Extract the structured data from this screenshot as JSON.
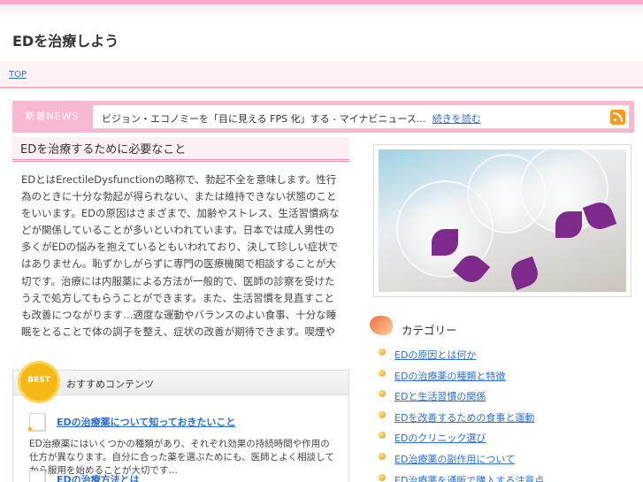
{
  "site": {
    "title": "EDを治療しよう"
  },
  "nav": {
    "top_label": "TOP"
  },
  "news": {
    "label": "新着NEWS",
    "headline": "ビジョン・エコノミーを「目に見える FPS 化」する - マイナビニュース...",
    "link_label": "続きを読む",
    "rss_icon": "rss-icon"
  },
  "main": {
    "heading": "EDを治療するために必要なこと",
    "body": "EDとはErectileDysfunctionの略称で、勃起不全を意味します。性行為のときに十分な勃起が得られない、または維持できない状態のことをいいます。EDの原因はさまざまで、加齢やストレス、生活習慣病などが関係していることが多いといわれています。日本では成人男性の多くがEDの悩みを抱えているともいわれており、決して珍しい症状ではありません。恥ずかしがらずに専門の医療機関で相談することが大切です。治療には内服薬による方法が一般的で、医師の診察を受けたうえで処方してもらうことができます。また、生活習慣を見直すことも改善につながります…適度な運動やバランスのよい食事、十分な睡眠をとることで体の調子を整え、症状の改善が期待できます。喫煙や過度の飲酒は血管に悪影響を与えるため、できるだけ控えるようにしましょう。パートナーとのコミュニケーションも大切です。一人で悩まずに、信頼できる医療機関で正しい知識と治療を受けるようにしましょう。インターネットで手軽に薬を購入できる時代になりましたが、偽造品も多く出回っているため注意が必要です。安全に治療を続けるためにも、必ず医師の指導のもとで服用するようにしましょう。"
  },
  "recommend": {
    "badge": "BEST",
    "title": "おすすめコンテンツ",
    "items": [
      {
        "link": "EDの治療薬について知っておきたいこと",
        "desc": "ED治療薬にはいくつかの種類があり、それぞれ効果の持続時間や作用の仕方が異なります。自分に合った薬を選ぶためにも、医師とよく相談してから服用を始めることが大切です…"
      },
      {
        "link": "EDの治療方法とは"
      }
    ]
  },
  "sidebar": {
    "category_title": "カテゴリー",
    "categories": [
      "EDの原因とは何か",
      "EDの治療薬の種類と特徴",
      "EDと生活習慣の関係",
      "EDを改善するための食事と運動",
      "EDのクリニック選び",
      "ED治療薬の副作用について",
      "ED治療薬を通販で購入する注意点"
    ]
  },
  "colors": {
    "accent": "#f9a8c8",
    "link": "#2d6fd0"
  }
}
